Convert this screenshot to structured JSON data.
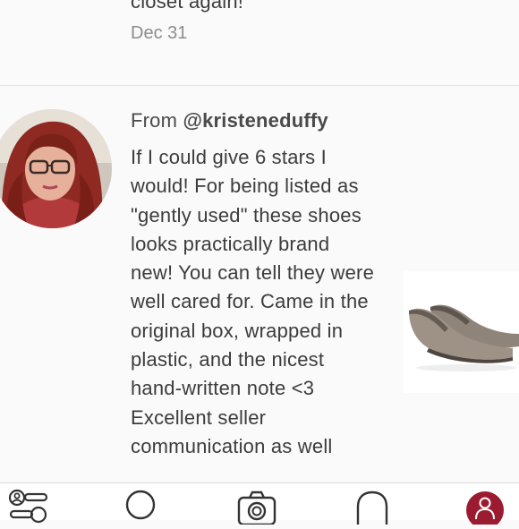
{
  "previous_comment": {
    "text_tail": "closet again!",
    "date": "Dec 31"
  },
  "comment": {
    "from_prefix": "From ",
    "username": "@kristeneduffy",
    "text": "If I could give 6 stars I would! For being listed as \"gently used\" these shoes looks practically brand new! You can tell they were well cared for. Came in the original box, wrapped in plastic, and the nicest hand-written note <3 Excellent seller communication as well"
  },
  "tabbar": {
    "items": [
      {
        "icon": "feed-list-icon"
      },
      {
        "icon": "search-icon"
      },
      {
        "icon": "camera-icon"
      },
      {
        "icon": "bell-icon"
      },
      {
        "icon": "account-icon",
        "active": true
      }
    ],
    "active_color": "#9b1b30"
  },
  "colors": {
    "background": "#fafafa",
    "text": "#3c3c3c",
    "date": "#8c8c8c"
  }
}
